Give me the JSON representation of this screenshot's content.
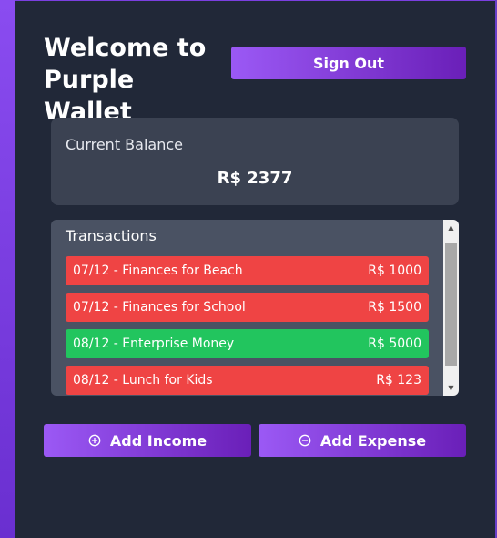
{
  "app": {
    "title": "Welcome to Purple Wallet"
  },
  "header": {
    "sign_out_label": "Sign Out"
  },
  "balance": {
    "label": "Current Balance",
    "value": "R$ 2377"
  },
  "transactions": {
    "header": "Transactions",
    "items": [
      {
        "description": "07/12 - Finances for Beach",
        "amount": "R$ 1000",
        "kind": "expense"
      },
      {
        "description": "07/12 - Finances for School",
        "amount": "R$ 1500",
        "kind": "expense"
      },
      {
        "description": "08/12 - Enterprise Money",
        "amount": "R$ 5000",
        "kind": "income"
      },
      {
        "description": "08/12 - Lunch for Kids",
        "amount": "R$ 123",
        "kind": "expense"
      }
    ]
  },
  "actions": {
    "add_income_label": "Add Income",
    "add_expense_label": "Add Expense",
    "add_income_icon": "plus-circle-icon",
    "add_expense_icon": "minus-circle-icon"
  },
  "colors": {
    "accent_start": "#9b59f5",
    "accent_end": "#6a1fb8",
    "expense": "#ef4444",
    "income": "#22c55e",
    "background": "#212838"
  }
}
